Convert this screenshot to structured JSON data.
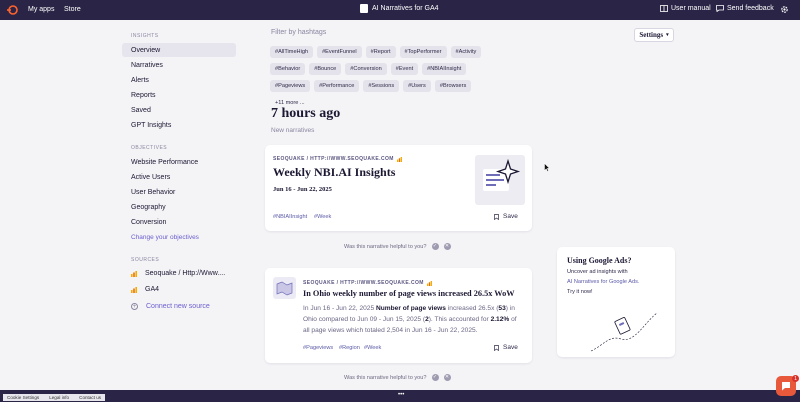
{
  "topbar": {
    "my_apps": "My apps",
    "store": "Store",
    "app_title": "AI Narratives for GA4",
    "user_manual": "User manual",
    "send_feedback": "Send feedback"
  },
  "sidebar": {
    "insights_label": "INSIGHTS",
    "insights": [
      "Overview",
      "Narratives",
      "Alerts",
      "Reports",
      "Saved",
      "GPT Insights"
    ],
    "objectives_label": "OBJECTIVES",
    "objectives": [
      "Website Performance",
      "Active Users",
      "User Behavior",
      "Geography",
      "Conversion"
    ],
    "change_objectives": "Change your objectives",
    "sources_label": "SOURCES",
    "sources": [
      "Seoquake / Http://Www....",
      "GA4"
    ],
    "connect_source": "Connect new source"
  },
  "filter": {
    "title": "Filter by hashtags",
    "tags": [
      "#AllTimeHigh",
      "#EventFunnel",
      "#Report",
      "#TopPerformer",
      "#Activity",
      "#Behavior",
      "#Bounce",
      "#Conversion",
      "#Event",
      "#NBIAIInsight",
      "#Pageviews",
      "#Performance",
      "#Sessions",
      "#Users",
      "#Browsers"
    ],
    "more": "+11 more ..."
  },
  "settings_label": "Settings",
  "feed": {
    "time_heading": "7 hours ago",
    "sub_heading": "New narratives",
    "card1": {
      "source": "SEOQUAKE / HTTP://WWW.SEOQUAKE.COM",
      "title": "Weekly NBI.AI Insights",
      "date": "Jun 16 - Jun 22, 2025",
      "hashtags": [
        "#NBIAIInsight",
        "#Week"
      ],
      "save": "Save"
    },
    "helpful": "Was this narrative helpful to you?",
    "card2": {
      "source": "SEOQUAKE / HTTP://WWW.SEOQUAKE.COM",
      "title": "In Ohio weekly number of page views increased 26.5x WoW",
      "text_1": "In Jun 16 - Jun 22, 2025",
      "text_2": "Number of page views",
      "text_3": "increased 26.5x (",
      "text_4": "53",
      "text_5": ") in Ohio compared to Jun 09 - Jun 15, 2025 (",
      "text_6": "2",
      "text_7": "). This accounted for",
      "text_8": "2.12%",
      "text_9": "of all page views which totaled 2,504 in Jun 16 - Jun 22, 2025.",
      "hashtags": [
        "#Pageviews",
        "#Region",
        "#Week"
      ],
      "save": "Save"
    },
    "helpful2": "Was this narrative helpful to you?"
  },
  "promo": {
    "title": "Using Google Ads?",
    "line1": "Uncover ad insights with",
    "link": "AI Narratives for Google Ads.",
    "line3": "Try it now!"
  },
  "cookie": {
    "settings": "Cookie Settings",
    "legal": "Legal info",
    "contact": "Contact us"
  },
  "chat_badge": "1",
  "colors": {
    "topbar": "#2a2546",
    "accent": "#6a5fcf",
    "chat": "#e8583a"
  }
}
